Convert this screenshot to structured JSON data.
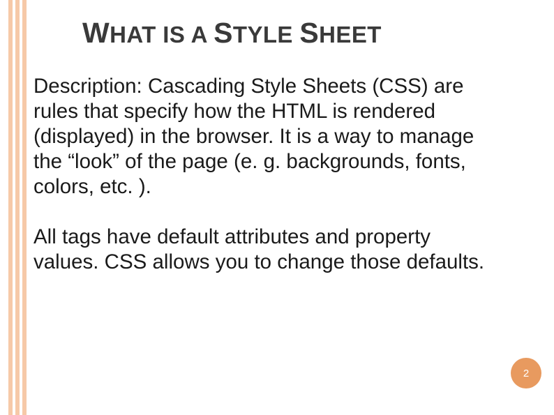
{
  "slide": {
    "title_parts": {
      "w": "W",
      "hat_is_a": "HAT IS A ",
      "s1": "S",
      "tyle": "TYLE ",
      "s2": "S",
      "heet": "HEET"
    },
    "paragraph1": "Description: Cascading Style Sheets (CSS) are rules that specify how the HTML is rendered (displayed) in the browser.  It is a way to manage the “look” of the page (e. g. backgrounds, fonts, colors, etc. ).",
    "paragraph2": "All tags have default attributes and property values.  CSS allows you to change those defaults.",
    "page_number": "2"
  },
  "colors": {
    "accent": "#f6c9a8",
    "badge": "#e89a5f"
  }
}
